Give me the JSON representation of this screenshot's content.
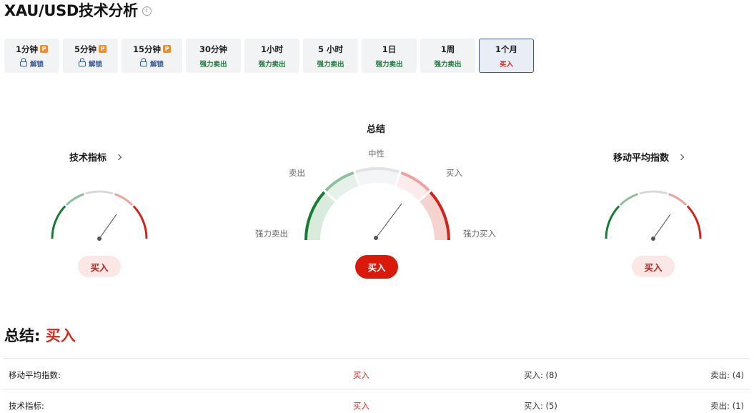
{
  "page": {
    "title": "XAU/USD技术分析"
  },
  "tabs": [
    {
      "label": "1分钟",
      "pro": true,
      "status": "解锁",
      "kind": "lock",
      "active": false
    },
    {
      "label": "5分钟",
      "pro": true,
      "status": "解锁",
      "kind": "lock",
      "active": false
    },
    {
      "label": "15分钟",
      "pro": true,
      "status": "解锁",
      "kind": "lock",
      "active": false
    },
    {
      "label": "30分钟",
      "pro": false,
      "status": "强力卖出",
      "kind": "sell",
      "active": false
    },
    {
      "label": "1小时",
      "pro": false,
      "status": "强力卖出",
      "kind": "sell",
      "active": false
    },
    {
      "label": "5 小时",
      "pro": false,
      "status": "强力卖出",
      "kind": "sell",
      "active": false
    },
    {
      "label": "1日",
      "pro": false,
      "status": "强力卖出",
      "kind": "sell",
      "active": false
    },
    {
      "label": "1周",
      "pro": false,
      "status": "强力卖出",
      "kind": "sell",
      "active": false
    },
    {
      "label": "1个月",
      "pro": false,
      "status": "买入",
      "kind": "buy",
      "active": true
    }
  ],
  "pro_badge": "P",
  "gauges": {
    "technical": {
      "title": "技术指标",
      "result": "买入"
    },
    "summary": {
      "title": "总结",
      "result": "买入",
      "labels": {
        "neutral": "中性",
        "sell": "卖出",
        "buy": "买入",
        "strong_sell": "强力卖出",
        "strong_buy": "强力买入"
      }
    },
    "moving_avg": {
      "title": "移动平均指数",
      "result": "买入"
    }
  },
  "summary": {
    "label": "总结:",
    "verdict": "买入",
    "rows": [
      {
        "label": "移动平均指数:",
        "verdict": "买入",
        "buy": "买入: (8)",
        "sell": "卖出: (4)"
      },
      {
        "label": "技术指标:",
        "verdict": "买入",
        "buy": "买入: (5)",
        "sell": "卖出: (1)"
      }
    ]
  },
  "colors": {
    "strong_sell": "#177a35",
    "sell": "#8fbf9c",
    "neutral": "#d7d8da",
    "buy": "#eaa49c",
    "strong_buy": "#d0231a",
    "accent_red": "#d91a0b",
    "active_tab_border": "#3d5a8a"
  }
}
